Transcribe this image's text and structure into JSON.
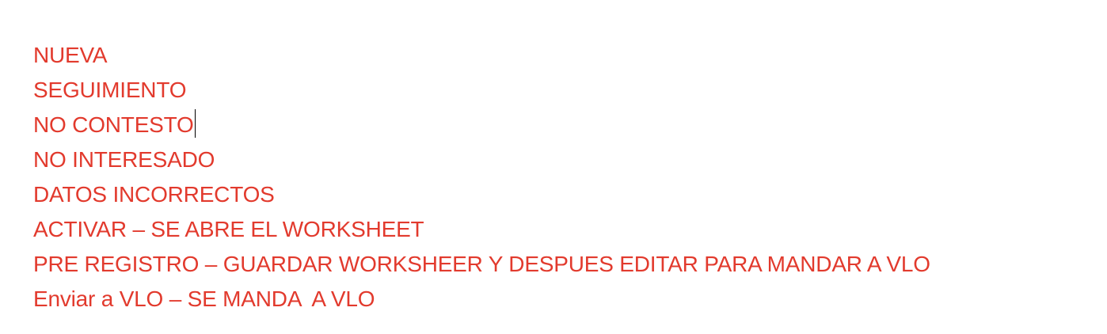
{
  "document": {
    "text_color": "#e23a2d",
    "lines": [
      "NUEVA",
      "SEGUIMIENTO",
      "NO CONTESTO",
      "NO INTERESADO",
      "DATOS INCORRECTOS",
      "ACTIVAR – SE ABRE EL WORKSHEET",
      "PRE REGISTRO – GUARDAR WORKSHEER Y DESPUES EDITAR PARA MANDAR A VLO",
      "Enviar a VLO – SE MANDA  A VLO"
    ]
  }
}
